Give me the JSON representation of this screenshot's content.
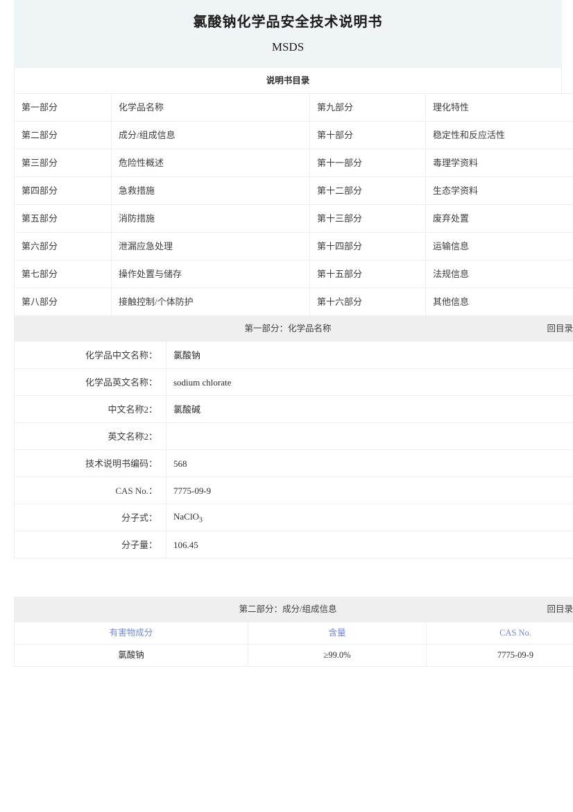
{
  "header": {
    "title": "氯酸钠化学品安全技术说明书",
    "subtitle": "MSDS",
    "toc_caption": "说明书目录"
  },
  "toc": {
    "rows": [
      {
        "left_no": "第一部分",
        "left_label": "化学品名称",
        "right_no": "第九部分",
        "right_label": "理化特性"
      },
      {
        "left_no": "第二部分",
        "left_label": "成分/组成信息",
        "right_no": "第十部分",
        "right_label": "稳定性和反应活性"
      },
      {
        "left_no": "第三部分",
        "left_label": "危险性概述",
        "right_no": "第十一部分",
        "right_label": "毒理学资料"
      },
      {
        "left_no": "第四部分",
        "left_label": "急救措施",
        "right_no": "第十二部分",
        "right_label": "生态学资料"
      },
      {
        "left_no": "第五部分",
        "left_label": "消防措施",
        "right_no": "第十三部分",
        "right_label": "废弃处置"
      },
      {
        "left_no": "第六部分",
        "left_label": "泄漏应急处理",
        "right_no": "第十四部分",
        "right_label": "运输信息"
      },
      {
        "left_no": "第七部分",
        "left_label": "操作处置与储存",
        "right_no": "第十五部分",
        "right_label": "法规信息"
      },
      {
        "left_no": "第八部分",
        "left_label": "接触控制/个体防护",
        "right_no": "第十六部分",
        "right_label": "其他信息"
      }
    ]
  },
  "section1": {
    "bar_title": "第一部分：化学品名称",
    "back_label": "回目录",
    "rows": [
      {
        "label": "化学品中文名称：",
        "value": "氯酸钠",
        "color": "blue"
      },
      {
        "label": "化学品英文名称：",
        "value": "sodium chlorate",
        "color": "blue"
      },
      {
        "label": "中文名称2：",
        "value": "氯酸碱",
        "color": "blue"
      },
      {
        "label": "英文名称2：",
        "value": "",
        "color": "blue"
      },
      {
        "label": "技术说明书编码：",
        "value": "568",
        "color": "green"
      },
      {
        "label": "CAS No.：",
        "value": "7775-09-9",
        "color": "navy"
      },
      {
        "label": "分子式：",
        "value": "NaClO3",
        "color": "green",
        "formula": true
      },
      {
        "label": "分子量：",
        "value": "106.45",
        "color": "green"
      }
    ]
  },
  "section2": {
    "bar_title": "第二部分：成分/组成信息",
    "back_label": "回目录",
    "columns": [
      "有害物成分",
      "含量",
      "CAS No."
    ],
    "rows": [
      {
        "component": "氯酸钠",
        "content": "≥99.0%",
        "cas": "7775-09-9"
      }
    ]
  }
}
